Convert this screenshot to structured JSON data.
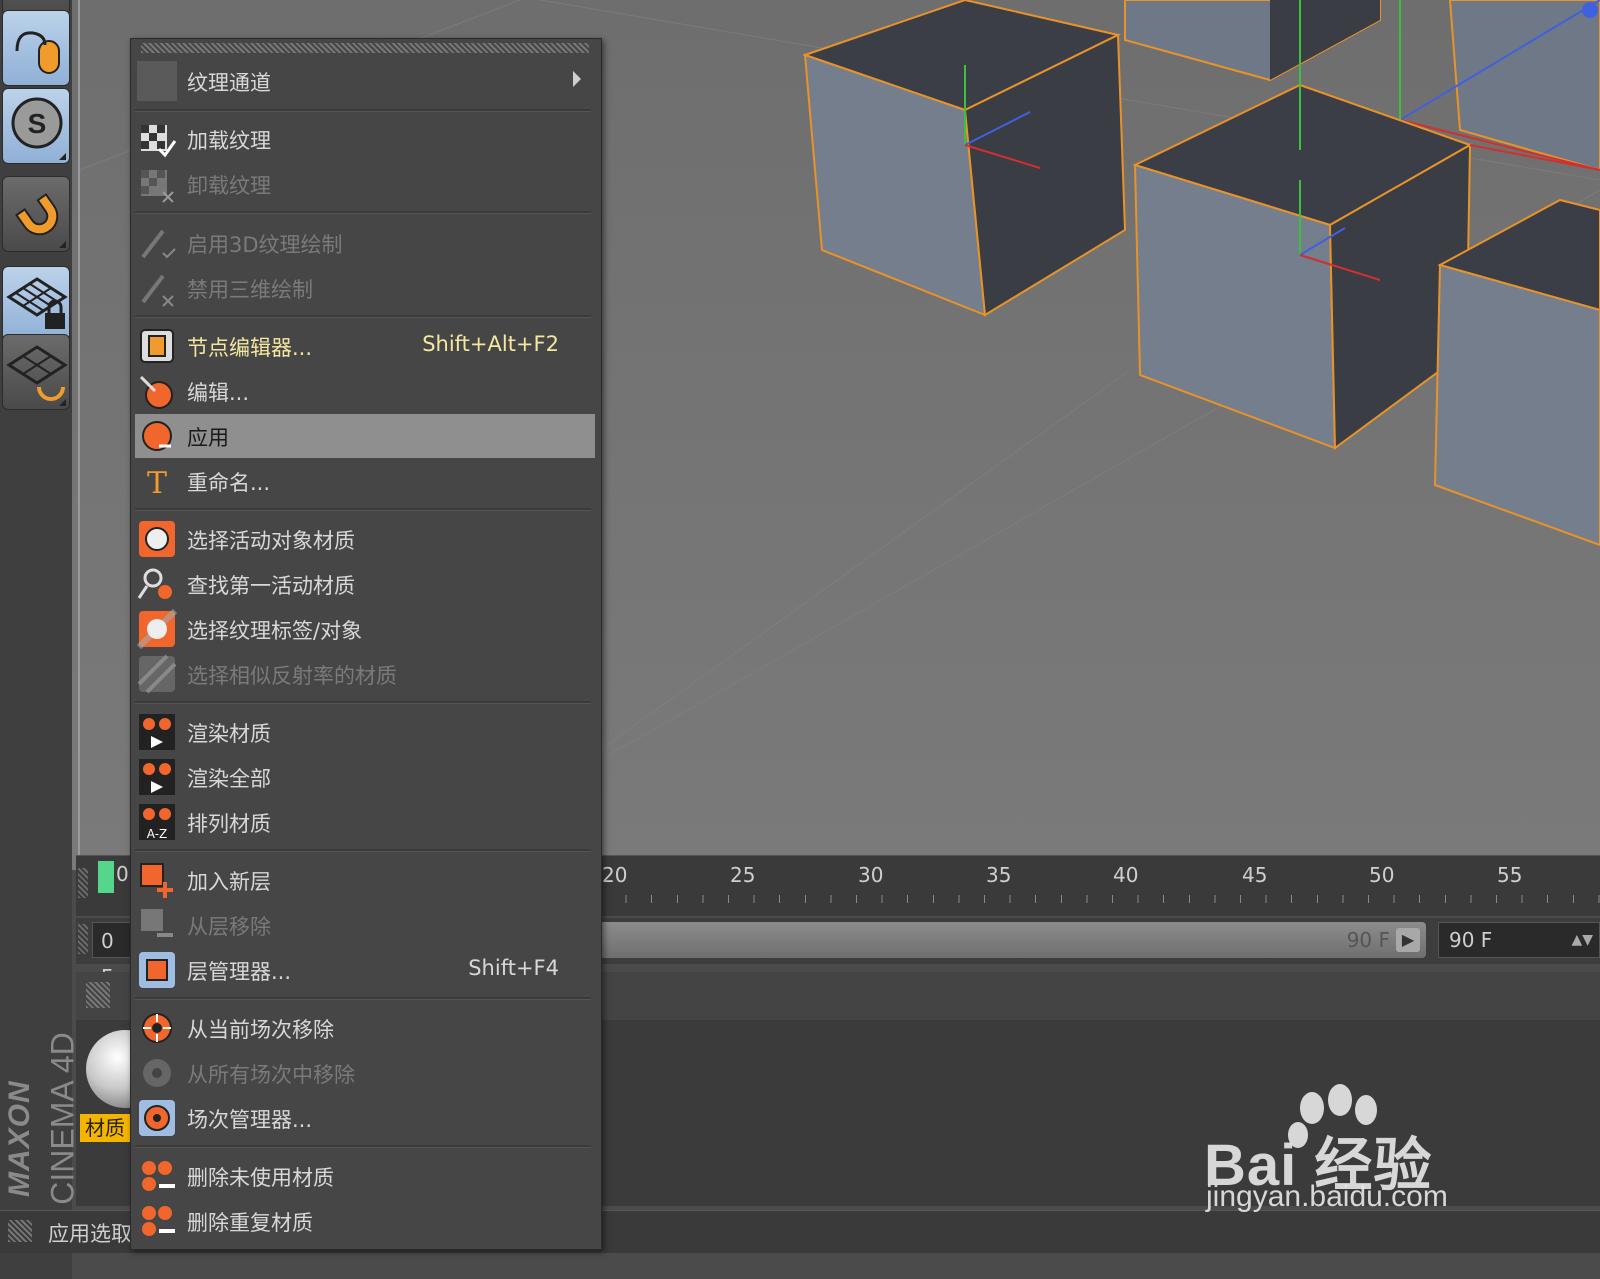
{
  "menu": {
    "items": [
      {
        "label": "纹理通道",
        "shortcut": "",
        "state": "submenu",
        "icon": "blank-icon"
      },
      {
        "label": "加载纹理",
        "shortcut": "",
        "state": "normal",
        "icon": "load-texture-icon"
      },
      {
        "label": "卸载纹理",
        "shortcut": "",
        "state": "disabled",
        "icon": "unload-texture-icon"
      },
      {
        "label": "启用3D纹理绘制",
        "shortcut": "",
        "state": "disabled",
        "icon": "enable-3d-paint-icon"
      },
      {
        "label": "禁用三维绘制",
        "shortcut": "",
        "state": "disabled",
        "icon": "disable-3d-paint-icon"
      },
      {
        "label": "节点编辑器...",
        "shortcut": "Shift+Alt+F2",
        "state": "accent",
        "icon": "node-editor-icon"
      },
      {
        "label": "编辑...",
        "shortcut": "",
        "state": "normal",
        "icon": "edit-icon"
      },
      {
        "label": "应用",
        "shortcut": "",
        "state": "highlight",
        "icon": "apply-icon"
      },
      {
        "label": "重命名...",
        "shortcut": "",
        "state": "normal",
        "icon": "rename-icon"
      },
      {
        "label": "选择活动对象材质",
        "shortcut": "",
        "state": "normal",
        "icon": "select-active-material-icon"
      },
      {
        "label": "查找第一活动材质",
        "shortcut": "",
        "state": "normal",
        "icon": "find-first-material-icon"
      },
      {
        "label": "选择纹理标签/对象",
        "shortcut": "",
        "state": "normal",
        "icon": "select-texture-tag-icon"
      },
      {
        "label": "选择相似反射率的材质",
        "shortcut": "",
        "state": "disabled",
        "icon": "select-similar-reflectance-icon"
      },
      {
        "label": "渲染材质",
        "shortcut": "",
        "state": "normal",
        "icon": "render-material-icon"
      },
      {
        "label": "渲染全部",
        "shortcut": "",
        "state": "normal",
        "icon": "render-all-icon"
      },
      {
        "label": "排列材质",
        "shortcut": "",
        "state": "normal",
        "icon": "sort-materials-icon"
      },
      {
        "label": "加入新层",
        "shortcut": "",
        "state": "normal",
        "icon": "add-layer-icon"
      },
      {
        "label": "从层移除",
        "shortcut": "",
        "state": "disabled",
        "icon": "remove-from-layer-icon"
      },
      {
        "label": "层管理器...",
        "shortcut": "Shift+F4",
        "state": "normal",
        "icon": "layer-manager-icon"
      },
      {
        "label": "从当前场次移除",
        "shortcut": "",
        "state": "normal",
        "icon": "remove-from-take-icon"
      },
      {
        "label": "从所有场次中移除",
        "shortcut": "",
        "state": "disabled",
        "icon": "remove-from-all-takes-icon"
      },
      {
        "label": "场次管理器...",
        "shortcut": "",
        "state": "normal",
        "icon": "take-manager-icon"
      },
      {
        "label": "删除未使用材质",
        "shortcut": "",
        "state": "normal",
        "icon": "delete-unused-icon"
      },
      {
        "label": "删除重复材质",
        "shortcut": "",
        "state": "normal",
        "icon": "delete-duplicate-icon"
      }
    ]
  },
  "timeline": {
    "current_frame": "0",
    "ticks": [
      "20",
      "25",
      "30",
      "35",
      "40",
      "45",
      "50",
      "55"
    ],
    "range_start": "0 F",
    "range_slider_end": "90 F",
    "range_end": "90 F"
  },
  "material_manager": {
    "material_label": "材质"
  },
  "status": {
    "text": "应用选取"
  },
  "brand": {
    "maxon": "MAXON",
    "product": "CINEMA 4D"
  },
  "watermark": {
    "main": "Bai 经验",
    "sub": "jingyan.baidu.com"
  },
  "colors": {
    "menu_bg": "#464646",
    "highlight": "#8f8f8f",
    "accent_text": "#f4e7a0",
    "selection_outline": "#e8922a",
    "tool_blue": "#9fbde0",
    "material_tag": "#f4b400",
    "frame_marker": "#55d68a"
  }
}
